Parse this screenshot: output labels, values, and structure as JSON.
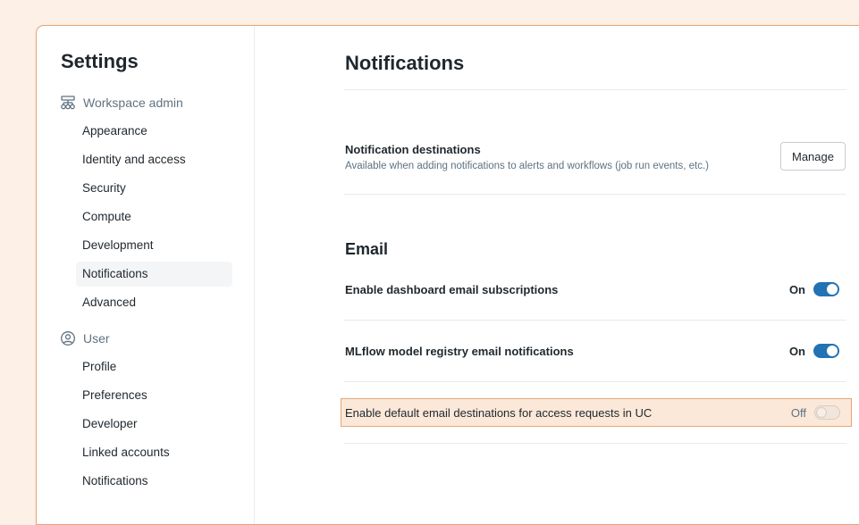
{
  "sidebar": {
    "title": "Settings",
    "groups": [
      {
        "label": "Workspace admin",
        "icon": "workspace-admin-icon",
        "items": [
          {
            "label": "Appearance"
          },
          {
            "label": "Identity and access"
          },
          {
            "label": "Security"
          },
          {
            "label": "Compute"
          },
          {
            "label": "Development"
          },
          {
            "label": "Notifications",
            "active": true
          },
          {
            "label": "Advanced"
          }
        ]
      },
      {
        "label": "User",
        "icon": "user-circle-icon",
        "items": [
          {
            "label": "Profile"
          },
          {
            "label": "Preferences"
          },
          {
            "label": "Developer"
          },
          {
            "label": "Linked accounts"
          },
          {
            "label": "Notifications"
          }
        ]
      }
    ]
  },
  "main": {
    "title": "Notifications",
    "destinations": {
      "title": "Notification destinations",
      "description": "Available when adding notifications to alerts and workflows (job run events, etc.)",
      "button_label": "Manage"
    },
    "email": {
      "section_title": "Email",
      "settings": [
        {
          "label": "Enable dashboard email subscriptions",
          "state": "On",
          "enabled": true
        },
        {
          "label": "MLflow model registry email notifications",
          "state": "On",
          "enabled": true
        },
        {
          "label": "Enable default email destinations for access requests in UC",
          "state": "Off",
          "enabled": false
        }
      ]
    }
  },
  "colors": {
    "accent": "#2272b4",
    "highlight_bg": "#fbe8d9",
    "highlight_border": "#e8a572",
    "page_bg": "#fdf0e6"
  }
}
